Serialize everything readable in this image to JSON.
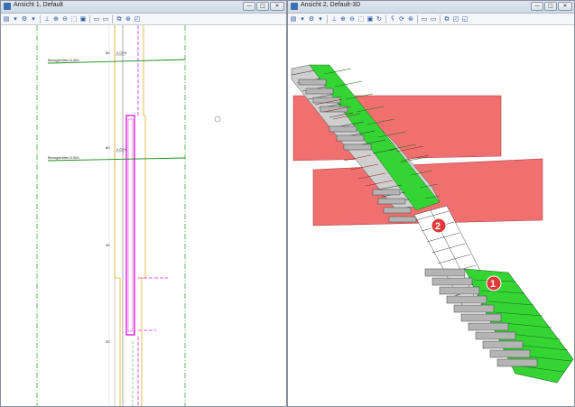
{
  "left_window": {
    "title": "Ansicht 1, Default",
    "labels": {
      "ref_height_1": "Bezugshöhe=0.000",
      "ref_height_2": "Bezugshöhe=0.000",
      "axis_80": "80",
      "axis_60": "60",
      "axis_40": "40",
      "axis_20": "20",
      "slope_top": "2.07%",
      "slope_mid": "2.07%"
    }
  },
  "right_window": {
    "title": "Ansicht 2, Default-3D",
    "markers": {
      "marker_1": "1",
      "marker_2": "2"
    }
  },
  "window_buttons": {
    "minimize": "—",
    "maximize": "□",
    "close": "✕"
  },
  "colors": {
    "green": "#35d435",
    "red_plane": "#f07070",
    "step_gray": "#a8a8a8",
    "marker_red": "#e23a3a",
    "magenta": "#e020e0",
    "yellow": "#e0b020",
    "green_dash": "#30b030"
  }
}
